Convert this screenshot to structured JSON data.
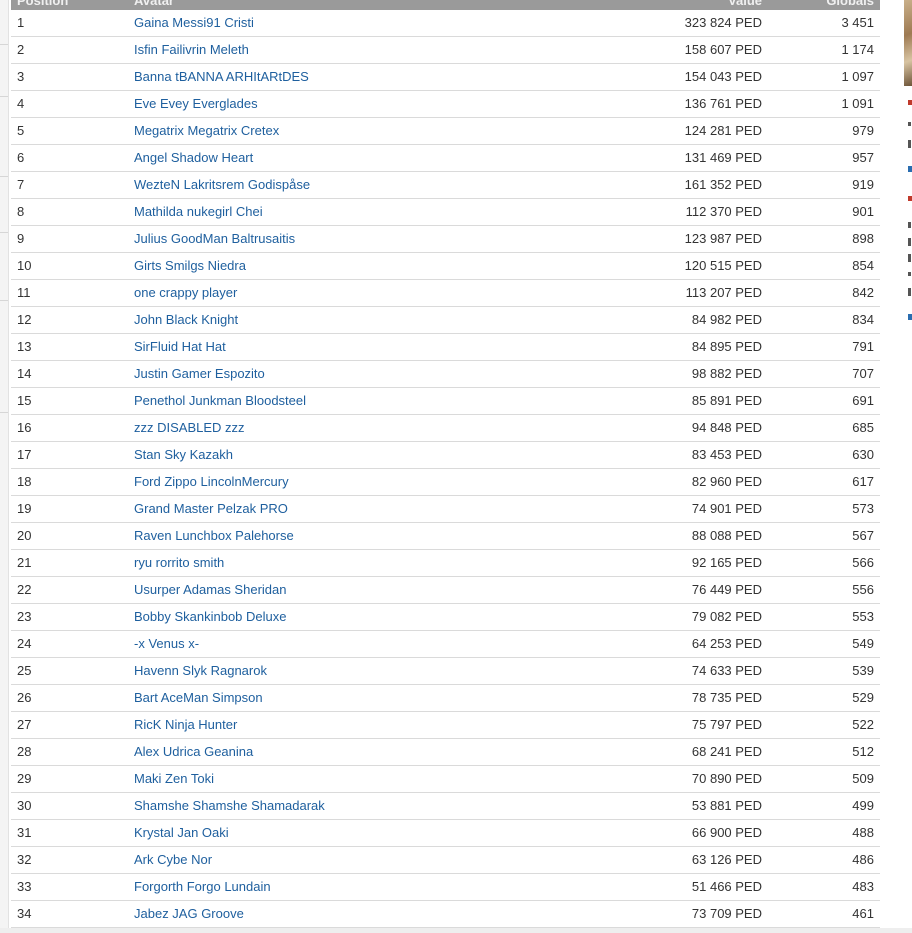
{
  "table": {
    "headers": {
      "position": "Position",
      "avatar": "Avatar",
      "value": "Value",
      "globals": "Globals"
    },
    "rows": [
      {
        "position": "1",
        "avatar": "Gaina Messi91 Cristi",
        "value": "323 824 PED",
        "globals": "3 451"
      },
      {
        "position": "2",
        "avatar": "Isfin Failivrin Meleth",
        "value": "158 607 PED",
        "globals": "1 174"
      },
      {
        "position": "3",
        "avatar": "Banna tBANNA ARHItARtDES",
        "value": "154 043 PED",
        "globals": "1 097"
      },
      {
        "position": "4",
        "avatar": "Eve Evey Everglades",
        "value": "136 761 PED",
        "globals": "1 091"
      },
      {
        "position": "5",
        "avatar": "Megatrix Megatrix Cretex",
        "value": "124 281 PED",
        "globals": "979"
      },
      {
        "position": "6",
        "avatar": "Angel Shadow Heart",
        "value": "131 469 PED",
        "globals": "957"
      },
      {
        "position": "7",
        "avatar": "WezteN Lakritsrem Godispåse",
        "value": "161 352 PED",
        "globals": "919"
      },
      {
        "position": "8",
        "avatar": "Mathilda nukegirl Chei",
        "value": "112 370 PED",
        "globals": "901"
      },
      {
        "position": "9",
        "avatar": "Julius GoodMan Baltrusaitis",
        "value": "123 987 PED",
        "globals": "898"
      },
      {
        "position": "10",
        "avatar": "Girts Smilgs Niedra",
        "value": "120 515 PED",
        "globals": "854"
      },
      {
        "position": "11",
        "avatar": "one crappy player",
        "value": "113 207 PED",
        "globals": "842"
      },
      {
        "position": "12",
        "avatar": "John Black Knight",
        "value": "84 982 PED",
        "globals": "834"
      },
      {
        "position": "13",
        "avatar": "SirFluid Hat Hat",
        "value": "84 895 PED",
        "globals": "791"
      },
      {
        "position": "14",
        "avatar": "Justin Gamer Espozito",
        "value": "98 882 PED",
        "globals": "707"
      },
      {
        "position": "15",
        "avatar": "Penethol Junkman Bloodsteel",
        "value": "85 891 PED",
        "globals": "691"
      },
      {
        "position": "16",
        "avatar": "zzz DISABLED zzz",
        "value": "94 848 PED",
        "globals": "685"
      },
      {
        "position": "17",
        "avatar": "Stan Sky Kazakh",
        "value": "83 453 PED",
        "globals": "630"
      },
      {
        "position": "18",
        "avatar": "Ford Zippo LincolnMercury",
        "value": "82 960 PED",
        "globals": "617"
      },
      {
        "position": "19",
        "avatar": "Grand Master Pelzak PRO",
        "value": "74 901 PED",
        "globals": "573"
      },
      {
        "position": "20",
        "avatar": "Raven Lunchbox Palehorse",
        "value": "88 088 PED",
        "globals": "567"
      },
      {
        "position": "21",
        "avatar": "ryu rorrito smith",
        "value": "92 165 PED",
        "globals": "566"
      },
      {
        "position": "22",
        "avatar": "Usurper Adamas Sheridan",
        "value": "76 449 PED",
        "globals": "556"
      },
      {
        "position": "23",
        "avatar": "Bobby Skankinbob Deluxe",
        "value": "79 082 PED",
        "globals": "553"
      },
      {
        "position": "24",
        "avatar": "-x Venus x-",
        "value": "64 253 PED",
        "globals": "549"
      },
      {
        "position": "25",
        "avatar": "Havenn Slyk Ragnarok",
        "value": "74 633 PED",
        "globals": "539"
      },
      {
        "position": "26",
        "avatar": "Bart AceMan Simpson",
        "value": "78 735 PED",
        "globals": "529"
      },
      {
        "position": "27",
        "avatar": "RicK Ninja Hunter",
        "value": "75 797 PED",
        "globals": "522"
      },
      {
        "position": "28",
        "avatar": "Alex Udrica Geanina",
        "value": "68 241 PED",
        "globals": "512"
      },
      {
        "position": "29",
        "avatar": "Maki Zen Toki",
        "value": "70 890 PED",
        "globals": "509"
      },
      {
        "position": "30",
        "avatar": "Shamshe Shamshe Shamadarak",
        "value": "53 881 PED",
        "globals": "499"
      },
      {
        "position": "31",
        "avatar": "Krystal Jan Oaki",
        "value": "66 900 PED",
        "globals": "488"
      },
      {
        "position": "32",
        "avatar": "Ark Cybe Nor",
        "value": "63 126 PED",
        "globals": "486"
      },
      {
        "position": "33",
        "avatar": "Forgorth Forgo Lundain",
        "value": "51 466 PED",
        "globals": "483"
      },
      {
        "position": "34",
        "avatar": "Jabez JAG Groove",
        "value": "73 709 PED",
        "globals": "461"
      }
    ]
  },
  "colors": {
    "link": "#1e5f9e",
    "text": "#333333",
    "header_bg": "#9a9a9a",
    "row_border": "#dadada"
  }
}
